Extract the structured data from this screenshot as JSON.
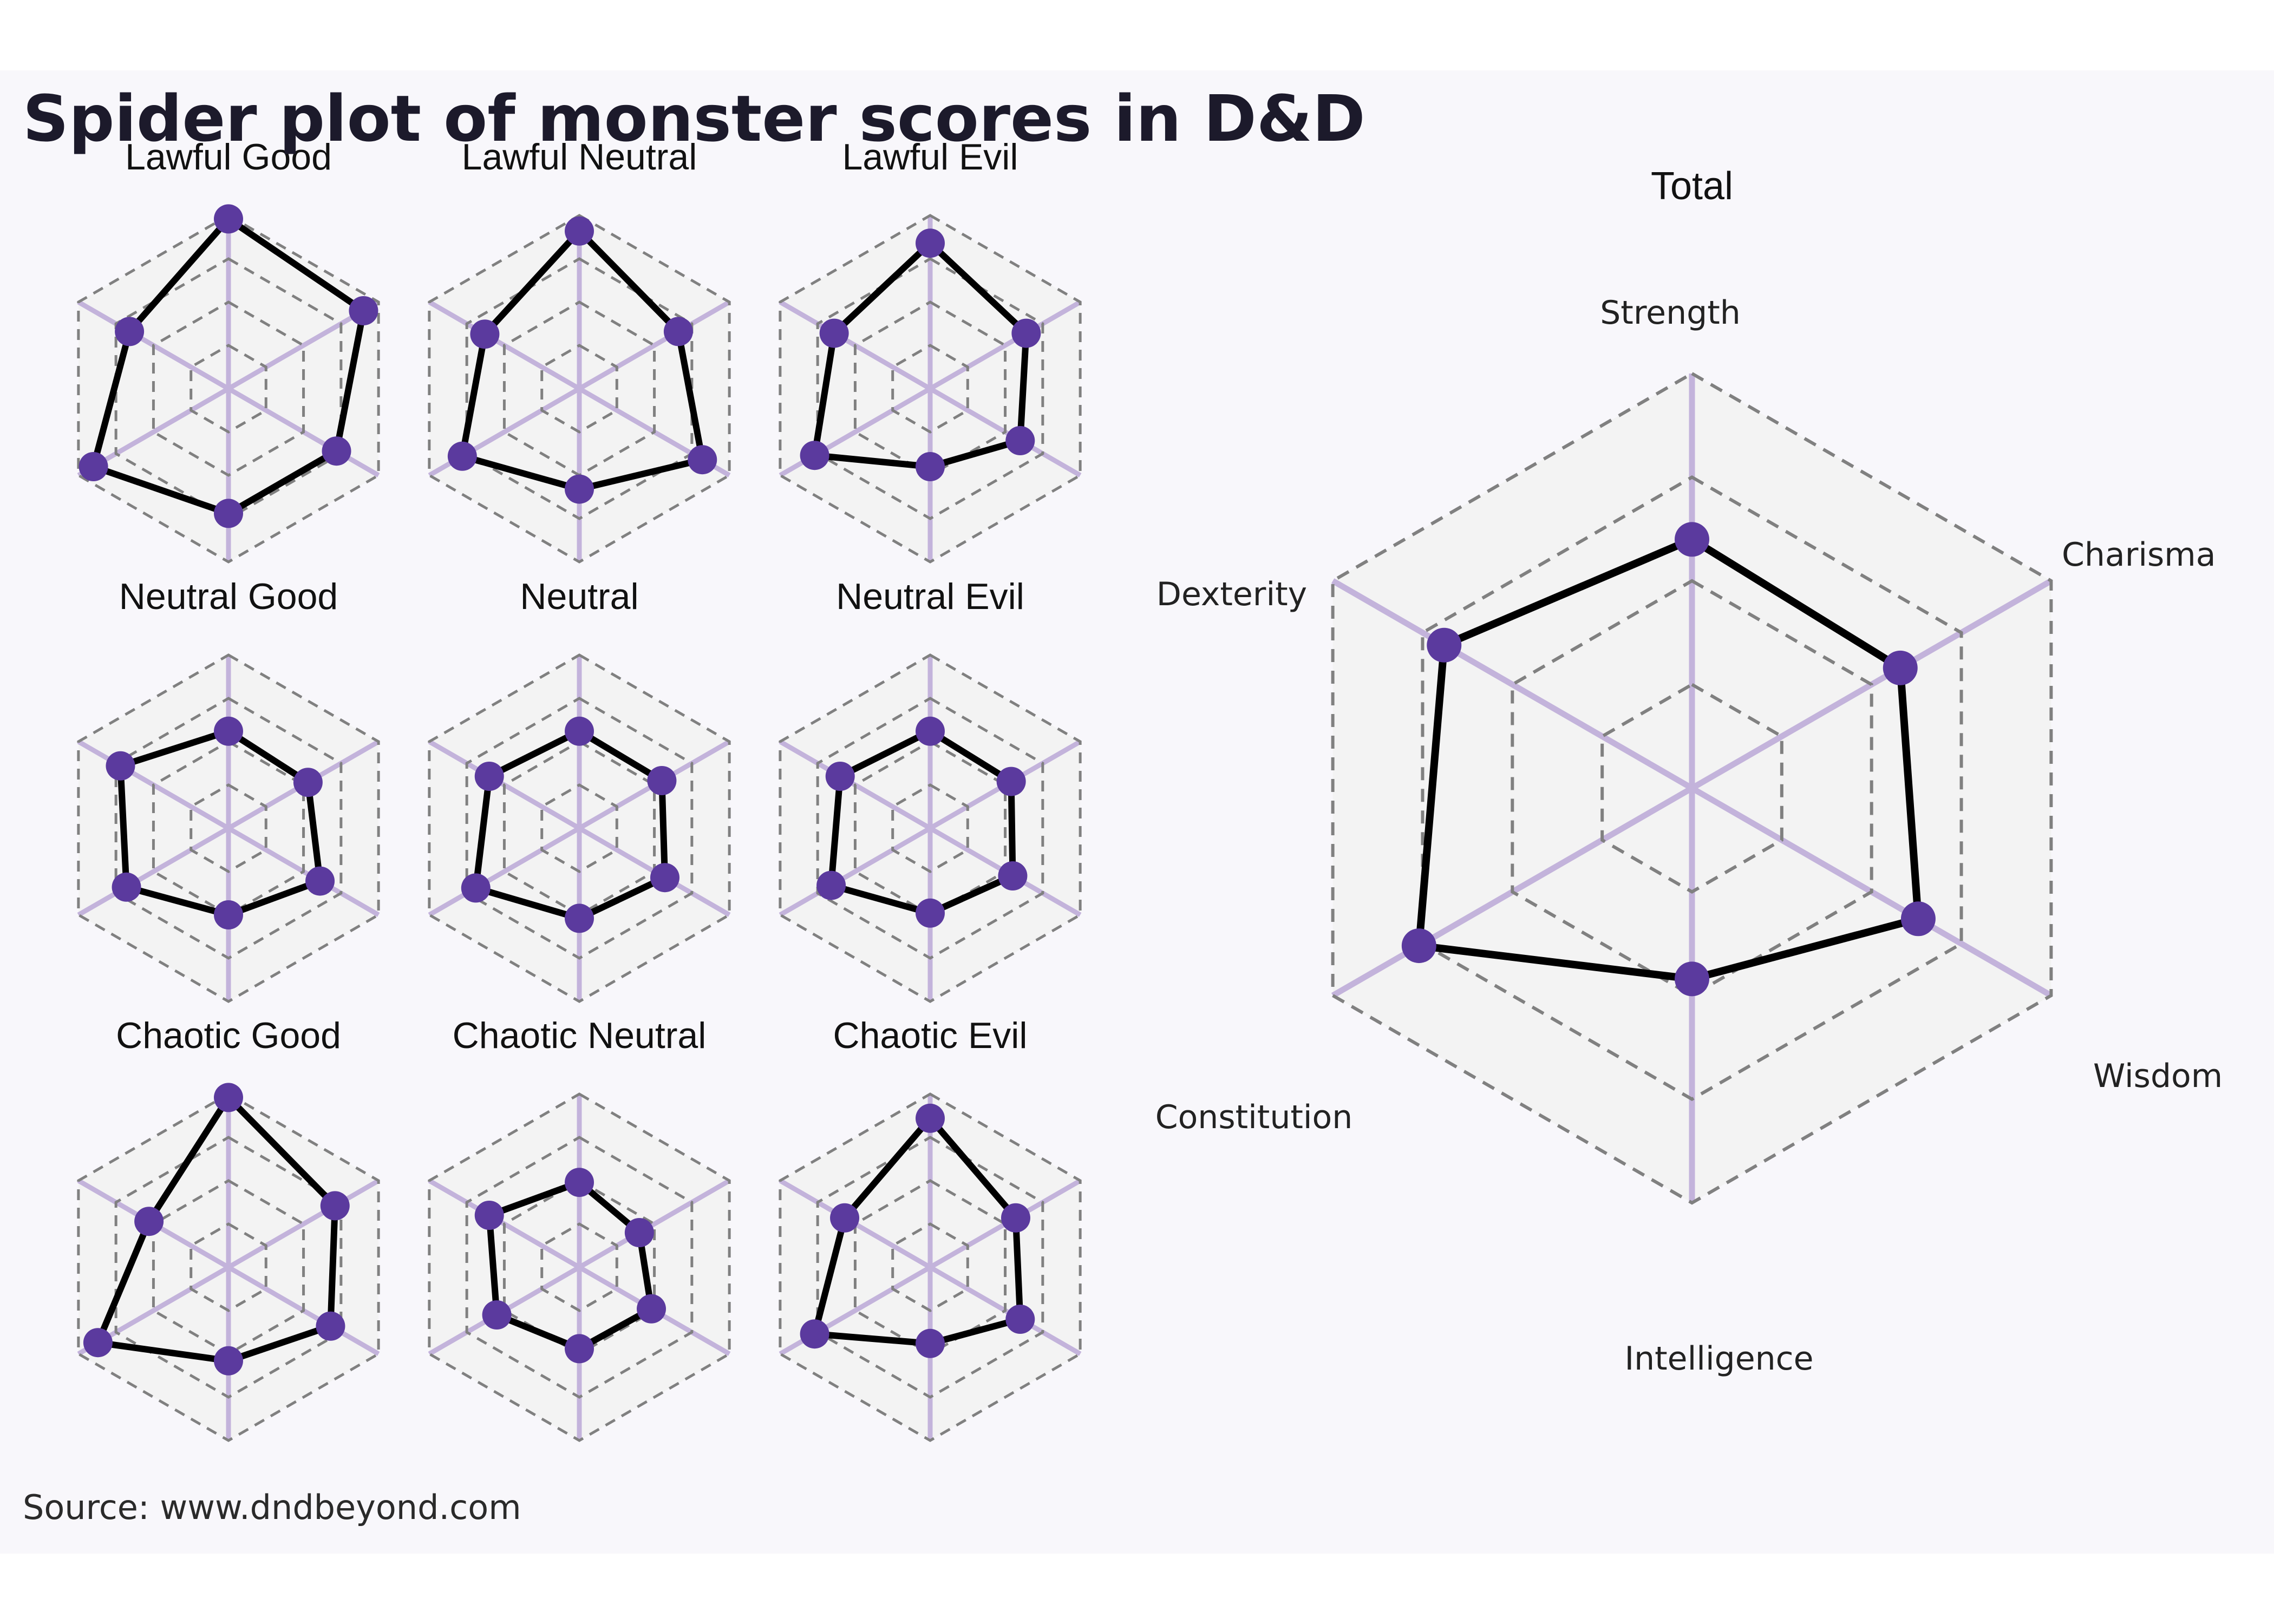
{
  "title": "Spider plot of monster scores in D&D",
  "source": "Source: www.dndbeyond.com",
  "chart_data": {
    "type": "radar",
    "axes": [
      "Strength",
      "Charisma",
      "Wisdom",
      "Intelligence",
      "Constitution",
      "Dexterity"
    ],
    "rlim": [
      0,
      1
    ],
    "grid": true,
    "colors": {
      "marker": "#5b3a9e",
      "line": "#000000",
      "spoke": "#c3b3db",
      "grid": "#808080",
      "fill": "#f3f3f3"
    },
    "charts": [
      {
        "title": "Lawful Good",
        "values": [
          0.98,
          0.9,
          0.72,
          0.72,
          0.9,
          0.66
        ]
      },
      {
        "title": "Lawful Neutral",
        "values": [
          0.91,
          0.66,
          0.82,
          0.58,
          0.78,
          0.63
        ]
      },
      {
        "title": "Lawful Evil",
        "values": [
          0.84,
          0.64,
          0.6,
          0.45,
          0.77,
          0.64
        ]
      },
      {
        "title": "Neutral Good",
        "values": [
          0.56,
          0.53,
          0.61,
          0.5,
          0.68,
          0.72
        ]
      },
      {
        "title": "Neutral",
        "values": [
          0.56,
          0.55,
          0.57,
          0.52,
          0.69,
          0.6
        ]
      },
      {
        "title": "Neutral Evil",
        "values": [
          0.56,
          0.54,
          0.55,
          0.49,
          0.66,
          0.6
        ]
      },
      {
        "title": "Chaotic Good",
        "values": [
          0.98,
          0.71,
          0.68,
          0.54,
          0.87,
          0.53
        ]
      },
      {
        "title": "Chaotic Neutral",
        "values": [
          0.49,
          0.4,
          0.48,
          0.47,
          0.55,
          0.6
        ]
      },
      {
        "title": "Chaotic Evil",
        "values": [
          0.86,
          0.57,
          0.6,
          0.44,
          0.77,
          0.57
        ]
      },
      {
        "title": "Total",
        "values": [
          0.6,
          0.58,
          0.63,
          0.46,
          0.76,
          0.69
        ]
      }
    ]
  }
}
